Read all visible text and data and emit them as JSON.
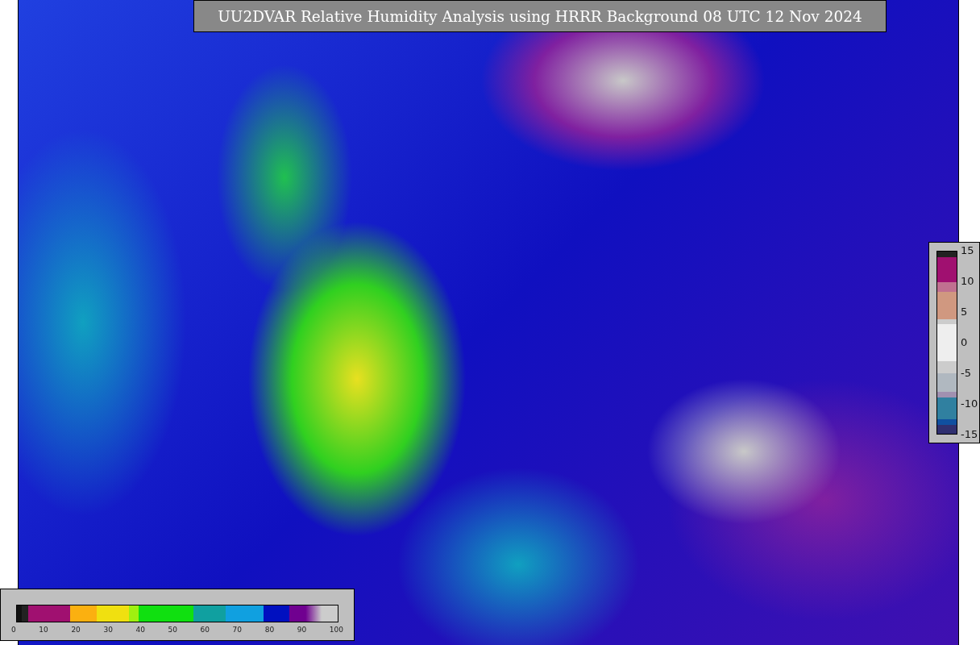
{
  "title": "UU2DVAR Relative Humidity Analysis using HRRR Background 08 UTC 12 Nov 2024",
  "side_colorbar": {
    "ticks": [
      "15",
      "10",
      "5",
      "0",
      "-5",
      "-10",
      "-15"
    ]
  },
  "bottom_colorbar": {
    "ticks": [
      "0",
      "10",
      "20",
      "30",
      "40",
      "50",
      "60",
      "70",
      "80",
      "90",
      "100"
    ]
  }
}
